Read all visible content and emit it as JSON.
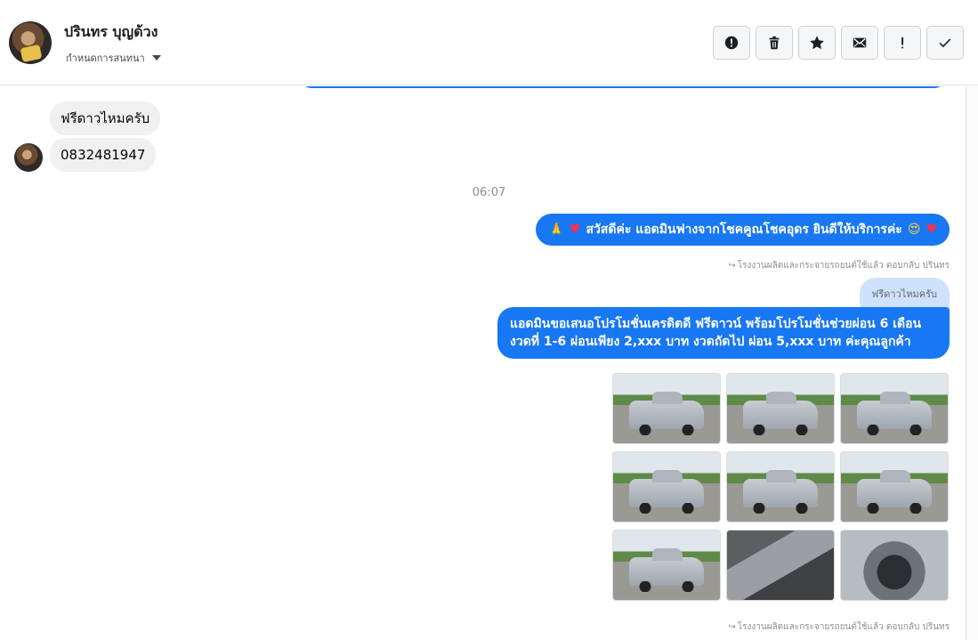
{
  "header": {
    "contact_name": "ปรินทร บุญด้วง",
    "conversation_label": "กำหนดการสนทนา",
    "actions": [
      {
        "name": "spam-button",
        "icon": "alert-circle-icon"
      },
      {
        "name": "delete-button",
        "icon": "trash-icon"
      },
      {
        "name": "star-button",
        "icon": "star-icon"
      },
      {
        "name": "mark-unread-button",
        "icon": "envelope-icon"
      },
      {
        "name": "important-button",
        "icon": "exclamation-icon"
      },
      {
        "name": "done-button",
        "icon": "check-icon"
      }
    ]
  },
  "thread": {
    "incoming": [
      {
        "text": "ฟรีดาวไหมครับ"
      },
      {
        "text": "0832481947"
      }
    ],
    "timestamp": "06:07",
    "greeting": {
      "text": "สวัสดีค่ะ แอดมินฟางจากโชคคูณโชคอุดร ยินดีให้บริการค่ะ"
    },
    "reply_note_1": "โรงงานผลิตและกระจายรถยนต์ใช้แล้ว ตอบกลับ ปรินทร",
    "quoted_text": "ฟรีดาวไหมครับ",
    "promo_text_line1": "แอดมินขอเสนอโปรโมชั่นเครดิตดี ฟรีดาวน์ พร้อมโปรโมชั่นช่วยผ่อน 6 เดือน",
    "promo_text_line2": "งวดที่ 1-6 ผ่อนเพียง 2,xxx บาท งวดถัดไป ผ่อน 5,xxx บาท ค่ะคุณลูกค้า",
    "reply_note_2": "โรงงานผลิตและกระจายรถยนต์ใช้แล้ว ตอบกลับ ปรินทร"
  },
  "colors": {
    "accent": "#1877f2",
    "incoming_bubble": "#f0f0f0",
    "quote_bubble": "#cfe2fd"
  }
}
